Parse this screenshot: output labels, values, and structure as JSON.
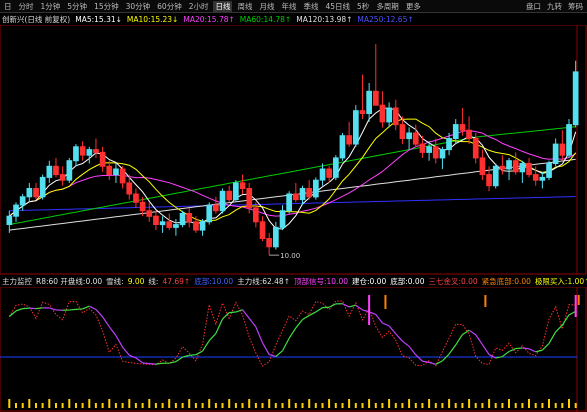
{
  "toolbar": {
    "items": [
      "日",
      "分时",
      "1分钟",
      "5分钟",
      "15分钟",
      "30分钟",
      "60分钟",
      "2小时",
      "日线",
      "周线",
      "月线",
      "年线",
      "季线",
      "45日线",
      "5秒",
      "多周期",
      "更多"
    ],
    "active_index": 8,
    "right": [
      "盘口",
      "九转",
      "筹码"
    ]
  },
  "ma_bar": {
    "symbol": "创新兴(日线 前复权)",
    "ma5": "MA5:15.31↓",
    "ma10": "MA10:15.23↓",
    "ma20": "MA20:15.78↑",
    "ma60": "MA60:14.78↑",
    "ma120": "MA120:13.98↑",
    "ma250": "MA250:12.65↑"
  },
  "indicator_bar": {
    "title": "主力监控",
    "items": [
      {
        "label": "R8:60 开盘线:0.00",
        "color": "#e0e0e0"
      },
      {
        "label": "雪线:",
        "color": "#e0e0e0"
      },
      {
        "label": "9.00",
        "color": "#ffff00"
      },
      {
        "label": "线:",
        "color": "#e0e0e0"
      },
      {
        "label": "47.69↑",
        "color": "#ff4040"
      },
      {
        "label": "底部:10.00",
        "color": "#4060ff"
      },
      {
        "label": "主力线:62.48↑",
        "color": "#e0e0e0"
      },
      {
        "label": "顶部信号:10.00",
        "color": "#ff40ff"
      },
      {
        "label": "建仓:0.00",
        "color": "#ffffff"
      },
      {
        "label": "底部:0.00",
        "color": "#ffffff"
      },
      {
        "label": "三七金叉:0.00",
        "color": "#ff4040"
      },
      {
        "label": "紧急底部:0.00",
        "color": "#ff8000"
      },
      {
        "label": "极限买入:1.00↑",
        "color": "#ffff00"
      }
    ]
  },
  "chart_data": {
    "type": "candlestick",
    "price_labels": {
      "low_marker": "10.00"
    },
    "candles": [
      [
        11.1,
        11.6,
        10.8,
        11.4
      ],
      [
        11.4,
        11.9,
        11.2,
        11.8
      ],
      [
        11.8,
        12.2,
        11.6,
        12.1
      ],
      [
        12.1,
        12.6,
        11.9,
        12.4
      ],
      [
        12.4,
        12.6,
        12.0,
        12.1
      ],
      [
        12.1,
        12.9,
        12.0,
        12.8
      ],
      [
        12.8,
        13.4,
        12.6,
        13.2
      ],
      [
        13.2,
        13.5,
        12.8,
        12.9
      ],
      [
        12.9,
        13.2,
        12.5,
        12.7
      ],
      [
        12.7,
        13.5,
        12.6,
        13.4
      ],
      [
        13.4,
        14.0,
        13.2,
        13.9
      ],
      [
        13.9,
        14.1,
        13.4,
        13.6
      ],
      [
        13.6,
        13.9,
        13.3,
        13.8
      ],
      [
        13.8,
        14.2,
        13.5,
        13.7
      ],
      [
        13.7,
        13.9,
        13.0,
        13.2
      ],
      [
        13.2,
        13.4,
        12.7,
        12.9
      ],
      [
        12.9,
        13.3,
        12.6,
        13.1
      ],
      [
        13.1,
        13.2,
        12.4,
        12.6
      ],
      [
        12.6,
        12.9,
        12.0,
        12.2
      ],
      [
        12.2,
        12.4,
        11.7,
        11.9
      ],
      [
        11.9,
        12.1,
        11.4,
        11.6
      ],
      [
        11.6,
        11.9,
        11.2,
        11.4
      ],
      [
        11.4,
        11.6,
        10.9,
        11.1
      ],
      [
        11.1,
        11.4,
        10.8,
        11.2
      ],
      [
        11.2,
        11.5,
        10.9,
        11.0
      ],
      [
        11.0,
        11.3,
        10.7,
        11.1
      ],
      [
        11.1,
        11.6,
        11.0,
        11.5
      ],
      [
        11.5,
        11.7,
        11.0,
        11.2
      ],
      [
        11.2,
        11.4,
        10.8,
        10.9
      ],
      [
        10.9,
        11.3,
        10.7,
        11.2
      ],
      [
        11.2,
        11.9,
        11.1,
        11.8
      ],
      [
        11.8,
        12.1,
        11.5,
        11.6
      ],
      [
        11.6,
        12.4,
        11.5,
        12.3
      ],
      [
        12.3,
        12.5,
        11.9,
        12.0
      ],
      [
        12.0,
        12.7,
        11.9,
        12.6
      ],
      [
        12.6,
        12.9,
        12.2,
        12.4
      ],
      [
        12.4,
        12.6,
        11.5,
        11.7
      ],
      [
        11.7,
        11.9,
        11.0,
        11.2
      ],
      [
        11.2,
        11.4,
        10.5,
        10.6
      ],
      [
        10.6,
        10.8,
        10.0,
        10.3
      ],
      [
        10.3,
        11.2,
        10.2,
        11.0
      ],
      [
        11.0,
        11.8,
        10.9,
        11.6
      ],
      [
        11.6,
        12.3,
        11.5,
        12.2
      ],
      [
        12.2,
        12.6,
        11.9,
        12.0
      ],
      [
        12.0,
        12.5,
        11.8,
        12.4
      ],
      [
        12.4,
        12.7,
        12.0,
        12.1
      ],
      [
        12.1,
        12.8,
        12.0,
        12.7
      ],
      [
        12.7,
        13.3,
        12.5,
        13.1
      ],
      [
        13.1,
        13.2,
        12.6,
        12.8
      ],
      [
        12.8,
        13.6,
        12.7,
        13.5
      ],
      [
        13.5,
        14.4,
        13.4,
        14.3
      ],
      [
        14.3,
        14.8,
        13.9,
        14.0
      ],
      [
        14.0,
        15.4,
        13.9,
        15.2
      ],
      [
        15.2,
        16.5,
        14.9,
        15.1
      ],
      [
        15.1,
        16.2,
        14.8,
        15.9
      ],
      [
        15.9,
        17.6,
        15.7,
        15.4
      ],
      [
        15.4,
        15.9,
        14.6,
        14.8
      ],
      [
        14.8,
        15.5,
        14.6,
        15.3
      ],
      [
        15.3,
        15.6,
        14.5,
        14.7
      ],
      [
        14.7,
        15.0,
        14.0,
        14.2
      ],
      [
        14.2,
        14.6,
        13.8,
        14.4
      ],
      [
        14.4,
        14.7,
        13.9,
        14.0
      ],
      [
        14.0,
        14.3,
        13.5,
        13.7
      ],
      [
        13.7,
        14.1,
        13.4,
        13.9
      ],
      [
        13.9,
        14.2,
        13.3,
        13.5
      ],
      [
        13.5,
        13.9,
        13.1,
        13.8
      ],
      [
        13.8,
        14.4,
        13.6,
        14.2
      ],
      [
        14.2,
        14.9,
        14.0,
        14.7
      ],
      [
        14.7,
        15.3,
        14.3,
        14.5
      ],
      [
        14.5,
        15.0,
        14.0,
        14.2
      ],
      [
        14.2,
        14.4,
        13.3,
        13.5
      ],
      [
        13.5,
        13.8,
        12.7,
        12.9
      ],
      [
        12.9,
        13.2,
        12.3,
        12.5
      ],
      [
        12.5,
        13.3,
        12.4,
        13.2
      ],
      [
        13.2,
        13.6,
        12.9,
        13.1
      ],
      [
        13.1,
        13.5,
        12.7,
        13.4
      ],
      [
        13.4,
        13.7,
        12.9,
        13.0
      ],
      [
        13.0,
        13.4,
        12.6,
        13.3
      ],
      [
        13.3,
        13.5,
        12.8,
        12.9
      ],
      [
        12.9,
        13.2,
        12.5,
        12.7
      ],
      [
        12.7,
        13.0,
        12.4,
        12.8
      ],
      [
        12.8,
        13.4,
        12.7,
        13.3
      ],
      [
        13.3,
        14.2,
        13.2,
        14.0
      ],
      [
        14.0,
        14.5,
        13.4,
        13.6
      ],
      [
        13.6,
        14.9,
        13.5,
        14.7
      ],
      [
        14.7,
        17.0,
        14.6,
        16.6
      ]
    ],
    "ma_colors": {
      "ma5": "#ffffff",
      "ma10": "#ffff00",
      "ma20": "#ff40ff",
      "ma60": "#00cc00",
      "ma120": "#e0e0e0",
      "ma250": "#3030ff"
    }
  },
  "colors": {
    "up": "#54e0f0",
    "down": "#ff3030",
    "background": "#000000",
    "grid": "#8b0000"
  }
}
